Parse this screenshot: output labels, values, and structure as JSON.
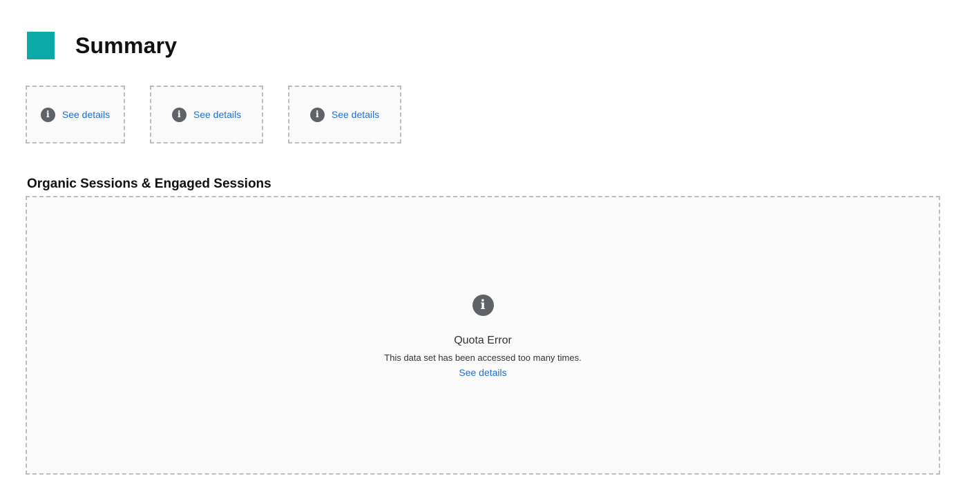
{
  "header": {
    "title": "Summary",
    "brand_color": "#0aa9a8"
  },
  "scorecards": [
    {
      "icon": "info-icon",
      "link_label": "See details"
    },
    {
      "icon": "info-icon",
      "link_label": "See details"
    },
    {
      "icon": "info-icon",
      "link_label": "See details"
    }
  ],
  "chart_section": {
    "title": "Organic Sessions & Engaged Sessions",
    "error": {
      "icon": "info-icon",
      "title": "Quota Error",
      "message": "This data set has been accessed too many times.",
      "link_label": "See details"
    }
  },
  "colors": {
    "link": "#1f6fd1",
    "icon": "#5f6368",
    "panel_background": "#fafafa",
    "dashed_border": "#bdbdbd"
  }
}
